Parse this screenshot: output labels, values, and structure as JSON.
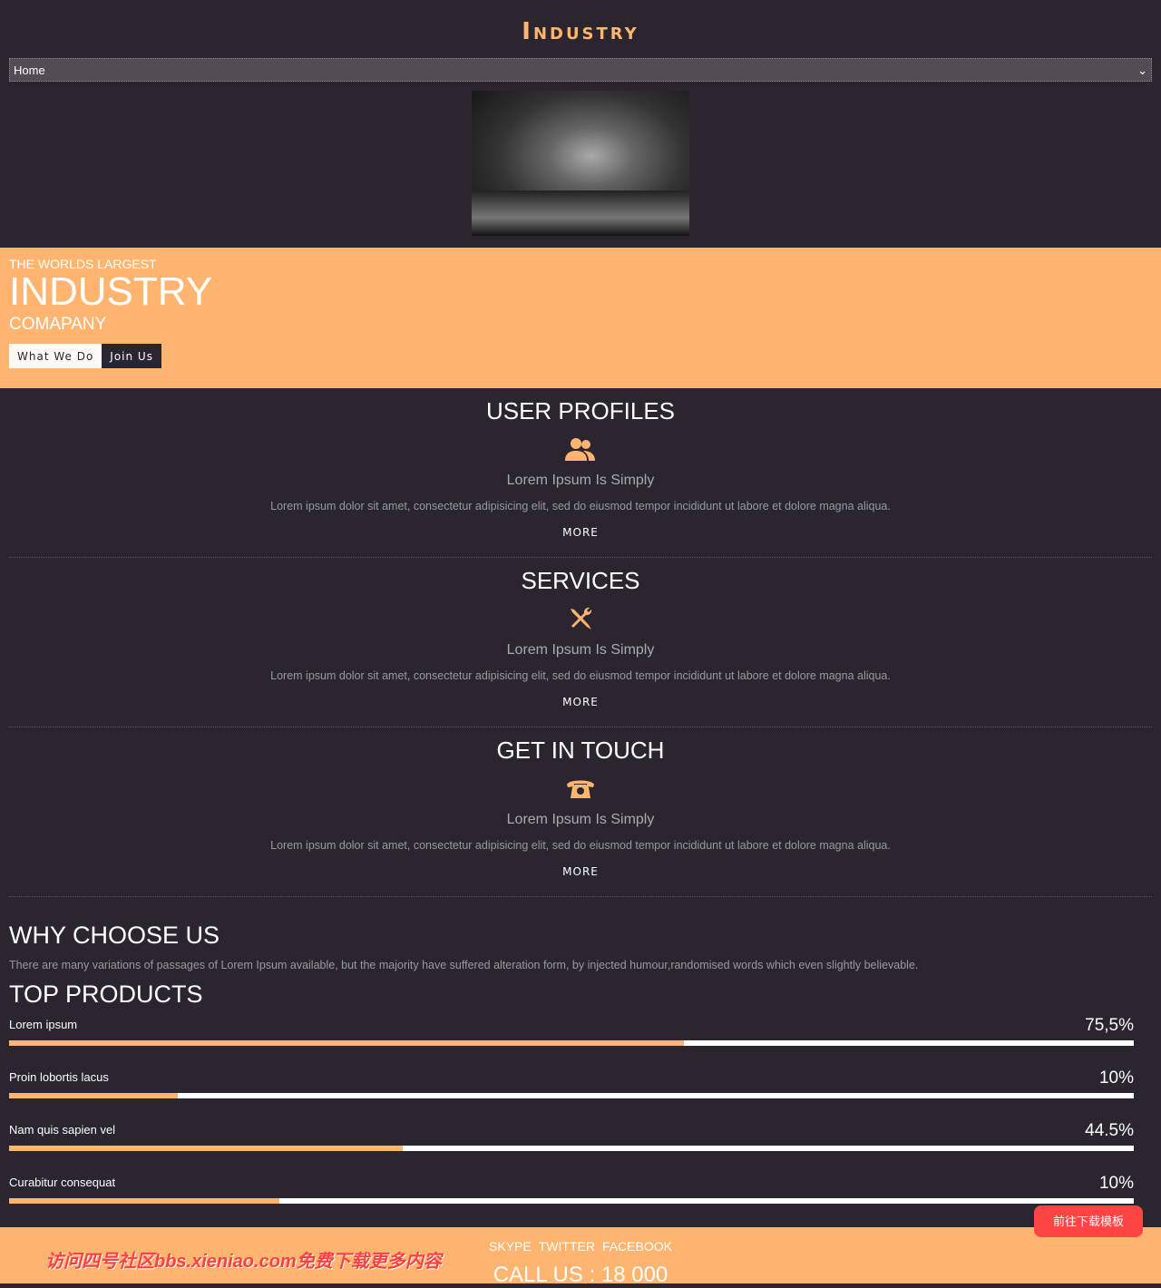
{
  "header": {
    "logo": "Industry",
    "nav_selected": "Home"
  },
  "banner": {
    "line1": "THE WORLDS LARGEST",
    "line2": "INDUSTRY",
    "line3": "COMAPANY",
    "btn_what": "What We Do",
    "btn_join": "Join Us"
  },
  "sections": [
    {
      "title": "USER PROFILES",
      "icon": "users-icon",
      "subtitle": "Lorem Ipsum Is Simply",
      "text": "Lorem ipsum dolor sit amet, consectetur adipisicing elit, sed do eiusmod tempor incididunt ut labore et dolore magna aliqua.",
      "more": "MORE"
    },
    {
      "title": "SERVICES",
      "icon": "tools-icon",
      "subtitle": "Lorem Ipsum Is Simply",
      "text": "Lorem ipsum dolor sit amet, consectetur adipisicing elit, sed do eiusmod tempor incididunt ut labore et dolore magna aliqua.",
      "more": "MORE"
    },
    {
      "title": "GET IN TOUCH",
      "icon": "phone-icon",
      "subtitle": "Lorem Ipsum Is Simply",
      "text": "Lorem ipsum dolor sit amet, consectetur adipisicing elit, sed do eiusmod tempor incididunt ut labore et dolore magna aliqua.",
      "more": "MORE"
    }
  ],
  "why": {
    "title": "WHY CHOOSE US",
    "text": "There are many variations of passages of Lorem Ipsum available, but the majority have suffered alteration form, by injected humour,randomised words which even slightly believable."
  },
  "products": {
    "title": "TOP PRODUCTS",
    "items": [
      {
        "label": "Lorem ipsum",
        "pct_text": "75,5%",
        "fill": 60
      },
      {
        "label": "Proin lobortis lacus",
        "pct_text": "10%",
        "fill": 15
      },
      {
        "label": "Nam quis sapien vel",
        "pct_text": "44.5%",
        "fill": 35
      },
      {
        "label": "Curabitur consequat",
        "pct_text": "10%",
        "fill": 24
      }
    ]
  },
  "footer": {
    "social": [
      "SKYPE",
      "TWITTER",
      "FACEBOOK"
    ],
    "call": "CALL US : 18 000"
  },
  "watermark": "访问四号社区bbs.xieniao.com免费下载更多内容",
  "download_button": "前往下载模板",
  "colors": {
    "accent": "#ffb570",
    "background": "#2b2530"
  }
}
